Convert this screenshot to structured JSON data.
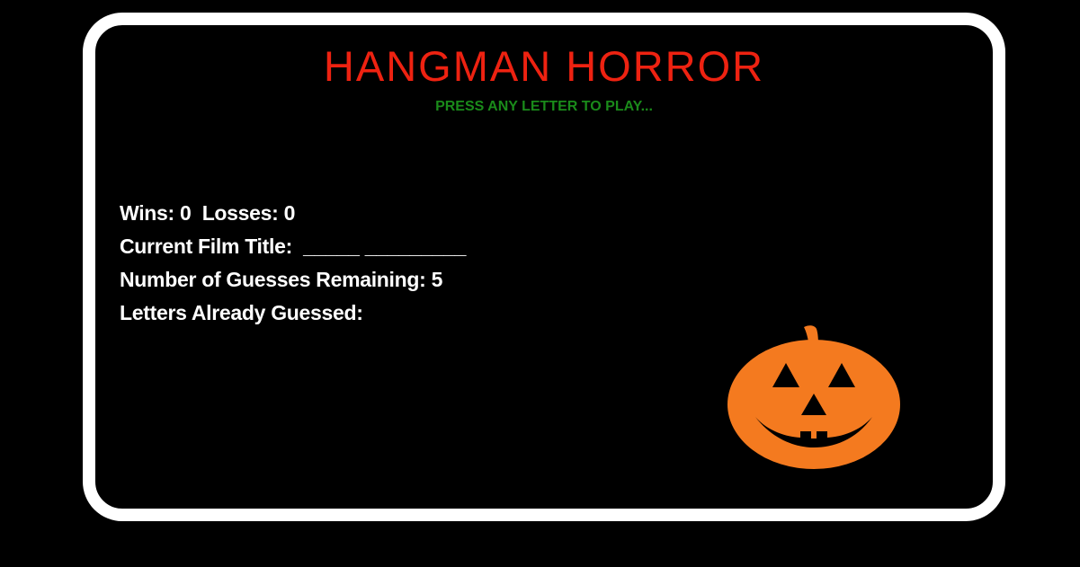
{
  "header": {
    "title": "HANGMAN HORROR",
    "subtitle": "PRESS ANY LETTER TO PLAY...",
    "title_color": "#ee2211",
    "subtitle_color": "#1a8a1a"
  },
  "stats": {
    "wins_label": "Wins:",
    "wins_value": "0",
    "losses_label": "Losses:",
    "losses_value": "0",
    "film_title_label": "Current Film Title:",
    "film_title_value": "_____ _________",
    "guesses_label": "Number of Guesses Remaining:",
    "guesses_value": "5",
    "letters_label": "Letters Already Guessed:",
    "letters_value": ""
  },
  "image": {
    "icon": "jack-o-lantern-icon",
    "pumpkin_color": "#f47a1f",
    "stem_color": "#f47a1f"
  },
  "colors": {
    "background": "#000000",
    "frame": "#ffffff",
    "text": "#ffffff"
  }
}
